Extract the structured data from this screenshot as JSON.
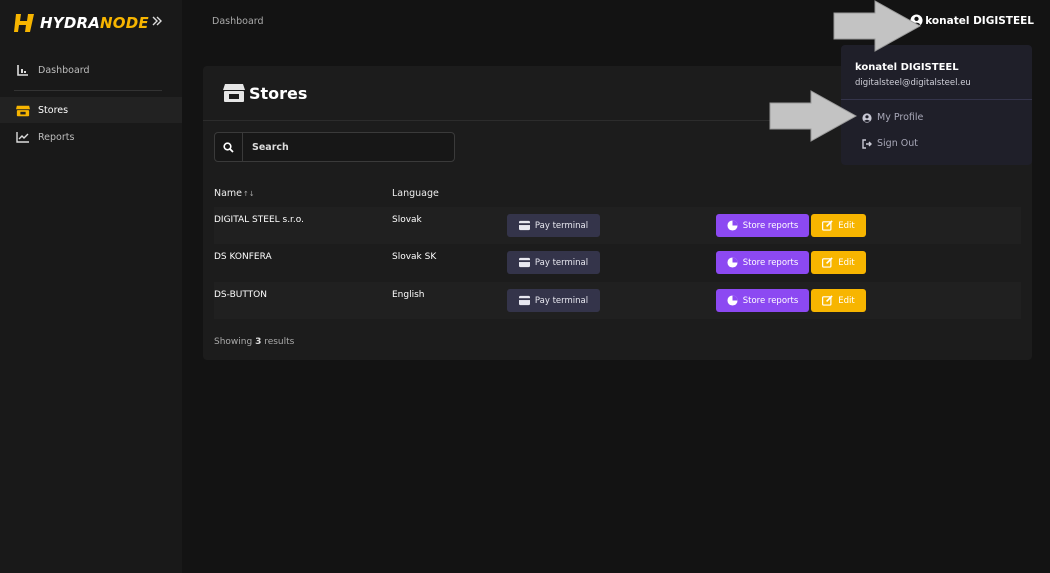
{
  "brand": {
    "hydra": "HYDRA",
    "node": "NODE"
  },
  "colors": {
    "accent": "#f7b500",
    "purple": "#8c49f2",
    "background": "#131313",
    "card": "#1c1c1c"
  },
  "sidebar": {
    "items": [
      {
        "label": "Dashboard",
        "icon": "dashboard-icon"
      },
      {
        "label": "Stores",
        "icon": "store-icon",
        "active": true
      },
      {
        "label": "Reports",
        "icon": "chart-line-icon"
      }
    ]
  },
  "header": {
    "breadcrumb": "Dashboard",
    "user": "konatel DIGISTEEL"
  },
  "main": {
    "title": "Stores",
    "search": {
      "placeholder": "Search",
      "value": ""
    },
    "table": {
      "columns": [
        "Name",
        "Language"
      ],
      "rows": [
        {
          "name": "DIGITAL STEEL s.r.o.",
          "language": "Slovak"
        },
        {
          "name": "DS KONFERA",
          "language": "Slovak SK"
        },
        {
          "name": "DS-BUTTON",
          "language": "English"
        }
      ],
      "actions": {
        "pay": "Pay terminal",
        "reports": "Store reports",
        "edit": "Edit"
      }
    },
    "showing": {
      "prefix": "Showing ",
      "count": "3",
      "suffix": " results"
    }
  },
  "dropdown": {
    "name": "konatel DIGISTEEL",
    "email": "digitalsteel@digitalsteel.eu",
    "items": [
      {
        "label": "My Profile",
        "icon": "user-circle-icon"
      },
      {
        "label": "Sign Out",
        "icon": "sign-out-icon"
      }
    ]
  }
}
